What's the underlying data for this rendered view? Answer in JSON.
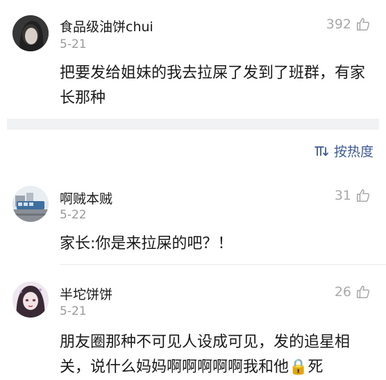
{
  "comments": [
    {
      "username": "食品级油饼chui",
      "date": "5-21",
      "likes": "392",
      "text": "把要发给姐妹的我去拉屎了发到了班群，有家长那种",
      "avatar_icon": "portrait-avatar-icon"
    },
    {
      "username": "啊贼本贼",
      "date": "5-22",
      "likes": "31",
      "text": "家长:你是来拉屎的吧？！",
      "avatar_icon": "street-scene-avatar-icon"
    },
    {
      "username": "半坨饼饼",
      "date": "5-21",
      "likes": "26",
      "text": "朋友圈那种不可见人设成可见，发的追星相关，说什么妈妈啊啊啊啊啊我和他🔒死",
      "avatar_icon": "drawn-girl-avatar-icon"
    }
  ],
  "sort": {
    "label": "按热度",
    "icon": "sort-icon"
  },
  "colors": {
    "link": "#3b5a9a",
    "muted": "#9a9a9a",
    "band": "#f1f2f4"
  }
}
